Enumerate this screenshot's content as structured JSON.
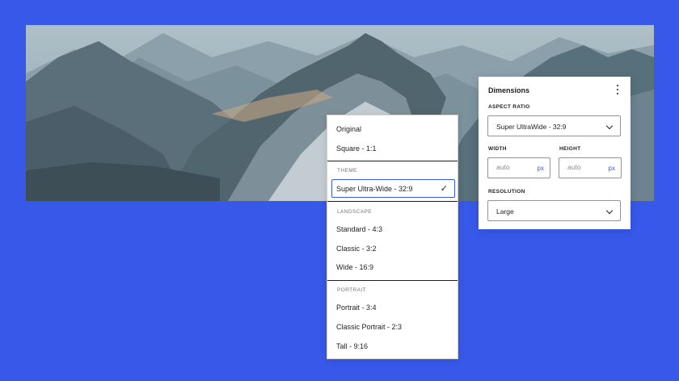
{
  "colors": {
    "background": "#3858e9",
    "accent": "#3858e9",
    "panel": "#ffffff",
    "text": "#1e1e1e",
    "muted": "#757575"
  },
  "aspect_menu": {
    "items_top": [
      "Original",
      "Square - 1:1"
    ],
    "theme_heading": "THEME",
    "theme_selected": "Super Ultra-Wide - 32:9",
    "check_icon": "checkmark-icon",
    "landscape_heading": "LANDSCAPE",
    "landscape_items": [
      "Standard - 4:3",
      "Classic - 3:2",
      "Wide - 16:9"
    ],
    "portrait_heading": "PORTRAIT",
    "portrait_items": [
      "Portrait - 3:4",
      "Classic Portrait - 2:3",
      "Tall - 9:16"
    ]
  },
  "dimensions_panel": {
    "title": "Dimensions",
    "menu_icon": "kebab-menu-icon",
    "aspect_ratio_label": "ASPECT RATIO",
    "aspect_ratio_value": "Super UltraWide - 32:9",
    "width_label": "WIDTH",
    "width_placeholder": "auto",
    "width_unit": "px",
    "height_label": "HEIGHT",
    "height_placeholder": "auto",
    "height_unit": "px",
    "resolution_label": "RESOLUTION",
    "resolution_value": "Large"
  }
}
